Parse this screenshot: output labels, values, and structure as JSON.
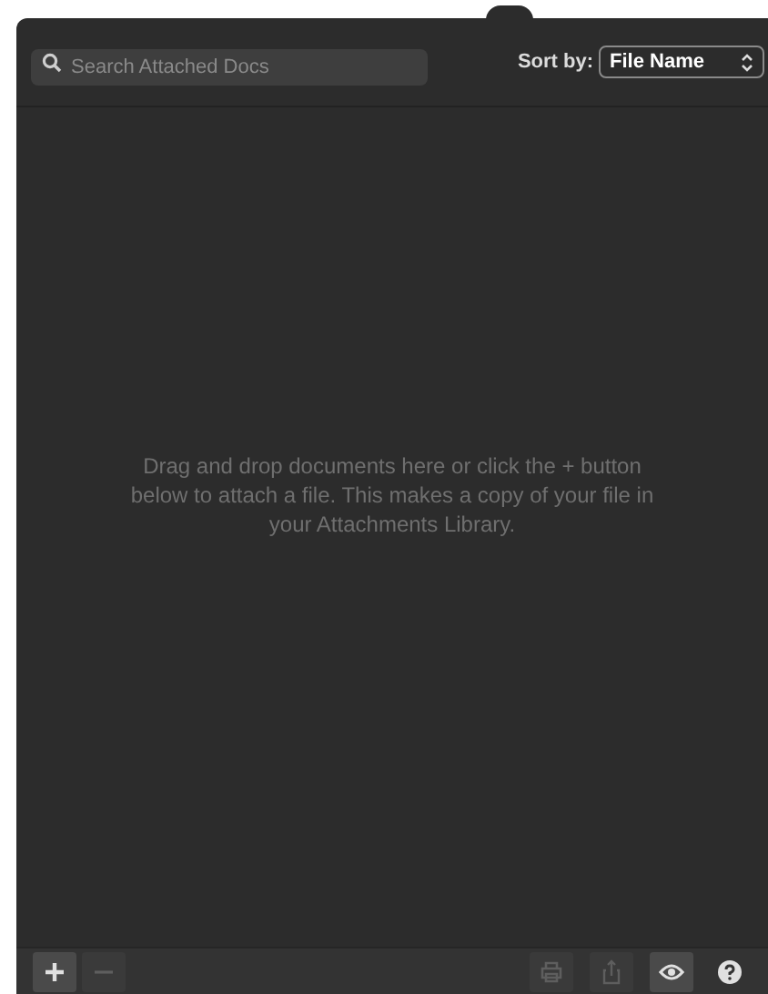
{
  "search": {
    "placeholder": "Search Attached Docs"
  },
  "sort": {
    "label": "Sort by:",
    "value": "File Name"
  },
  "empty_message": "Drag and drop documents here or click the + button below to attach a file. This makes a copy of your file in your Attachments Library.",
  "toolbar": [
    {
      "kind": "add",
      "disabled": false
    },
    {
      "kind": "remove",
      "disabled": true
    },
    {
      "kind": "print",
      "disabled": true
    },
    {
      "kind": "share",
      "disabled": true
    },
    {
      "kind": "preview",
      "disabled": false
    },
    {
      "kind": "help",
      "disabled": false
    }
  ]
}
